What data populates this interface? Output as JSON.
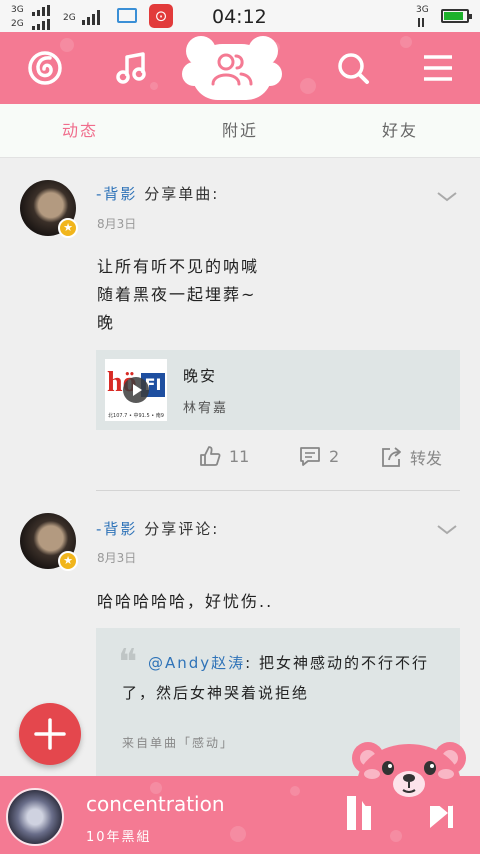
{
  "status_bar": {
    "sim1_network": "3G",
    "sim2_network": "2G",
    "sim3_network": "2G",
    "time": "04:12",
    "right_network": "3G",
    "battery_level": 0.85
  },
  "header": {
    "icons": [
      "netease-logo-icon",
      "music-note-icon",
      "friends-paw-icon",
      "search-icon",
      "menu-icon"
    ]
  },
  "tabs": [
    {
      "label": "动态",
      "active": true
    },
    {
      "label": "附近",
      "active": false
    },
    {
      "label": "好友",
      "active": false
    }
  ],
  "posts": [
    {
      "user": "-背影",
      "action": "分享单曲:",
      "date": "8月3日",
      "text": "让所有听不见的呐喊\n随着黑夜一起埋葬~\n晚",
      "song": {
        "name": "晚安",
        "artist": "林宥嘉",
        "cover_big_text": "hö",
        "cover_box_text": "FI",
        "cover_strip_text": "北107.7 • 中91.5 • 南9"
      },
      "likes": "11",
      "comments": "2",
      "share_label": "转发"
    },
    {
      "user": "-背影",
      "action": "分享评论:",
      "date": "8月3日",
      "text": "哈哈哈哈哈，好忧伤..",
      "quote": {
        "mention": "@Andy赵涛",
        "body": ": 把女神感动的不行不行了，然后女神哭着说拒绝",
        "source": "来自单曲「感动」"
      }
    }
  ],
  "player": {
    "title": "concentration",
    "artist": "10年黑組"
  },
  "colors": {
    "brand_pink": "#f47a93",
    "active_tab": "#f06d8c",
    "username_blue": "#2f73b8",
    "fab_red": "#e4474d"
  }
}
